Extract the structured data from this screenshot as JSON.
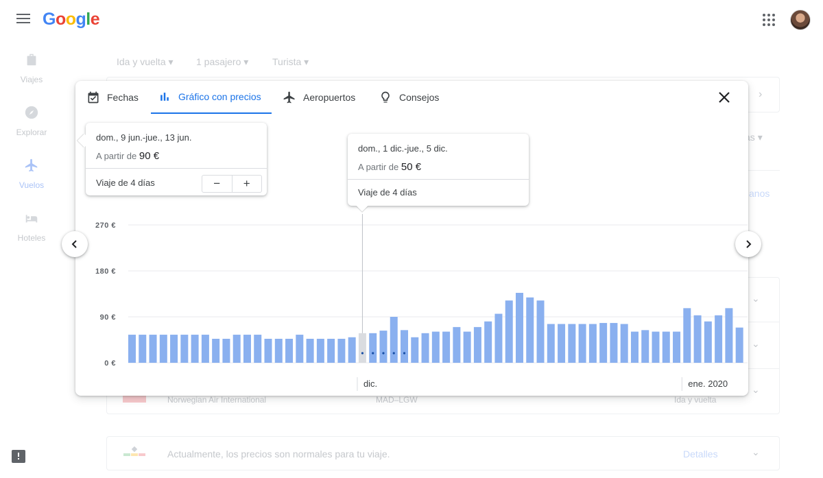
{
  "header": {
    "logo": [
      "G",
      "o",
      "o",
      "g",
      "l",
      "e"
    ]
  },
  "leftnav": {
    "items": [
      {
        "label": "Viajes"
      },
      {
        "label": "Explorar"
      },
      {
        "label": "Vuelos"
      },
      {
        "label": "Hoteles"
      }
    ]
  },
  "search_options": {
    "trip_type": "Ida y vuelta",
    "passengers": "1 pasajero",
    "cabin": "Turista"
  },
  "background": {
    "airline": "Norwegian Air International",
    "route": "MAD–LGW",
    "fare_type": "Ida y vuelta",
    "insight": "Actualmente, los precios son normales para tu viaje.",
    "details_link": "Detalles",
    "partial_a": "as",
    "partial_b": "anos"
  },
  "popup": {
    "tabs": [
      {
        "label": "Fechas",
        "icon": "calendar-check-icon"
      },
      {
        "label": "Gráfico con precios",
        "icon": "bar-chart-icon"
      },
      {
        "label": "Aeropuertos",
        "icon": "airplane-icon"
      },
      {
        "label": "Consejos",
        "icon": "lightbulb-icon"
      }
    ],
    "selected_card": {
      "dates": "dom., 9 jun.-jue., 13 jun.",
      "price_prefix": "A partir de",
      "price": "90 €",
      "trip_length": "Viaje de 4 días",
      "minus": "−",
      "plus": "+"
    },
    "hover_card": {
      "dates": "dom., 1 dic.-jue., 5 dic.",
      "price_prefix": "A partir de",
      "price": "50 €",
      "trip_length": "Viaje de 4 días"
    }
  },
  "colors": {
    "bar": "#8ab0ef",
    "bar_highlight": "#dadce0",
    "accent": "#1a73e8"
  },
  "chart_data": {
    "type": "bar",
    "y_ticks": [
      "270 €",
      "180 €",
      "90 €",
      "0 €"
    ],
    "ylim": [
      0,
      270
    ],
    "months": [
      {
        "label": "dic.",
        "start_index": 22
      },
      {
        "label": "ene. 2020",
        "start_index": 53
      }
    ],
    "highlight_index": 22,
    "dotted_indices": [
      22,
      23,
      24,
      25,
      26
    ],
    "values": [
      55,
      55,
      55,
      55,
      55,
      55,
      55,
      55,
      47,
      47,
      55,
      55,
      55,
      47,
      47,
      47,
      55,
      47,
      47,
      47,
      47,
      50,
      58,
      58,
      63,
      90,
      64,
      50,
      58,
      61,
      61,
      70,
      61,
      70,
      81,
      96,
      122,
      137,
      128,
      122,
      76,
      76,
      76,
      76,
      76,
      78,
      78,
      76,
      61,
      64,
      61,
      61,
      61,
      107,
      93,
      81,
      93,
      107,
      69
    ]
  }
}
